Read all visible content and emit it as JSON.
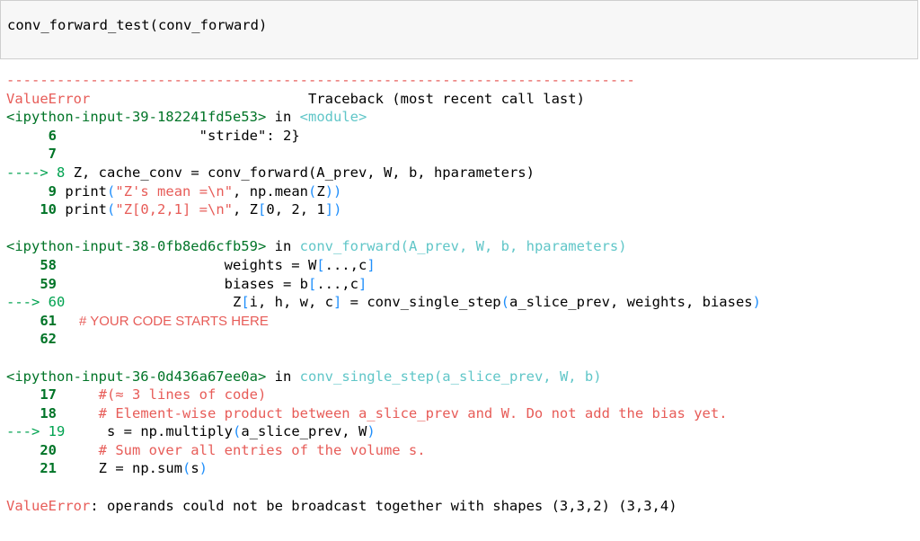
{
  "input": {
    "code": "conv_forward_test(conv_forward)"
  },
  "traceback": {
    "separator": "---------------------------------------------------------------------------",
    "error_name": "ValueError",
    "traceback_header": "Traceback (most recent call last)",
    "frames": [
      {
        "location": "<ipython-input-39-182241fd5e53>",
        "in": "in",
        "func": "<module>",
        "lines": [
          {
            "num": "6",
            "arrow": "",
            "code": "                \"stride\": 2}"
          },
          {
            "num": "7",
            "arrow": "",
            "code": ""
          },
          {
            "num": "8",
            "arrow": "----> ",
            "code": "Z, cache_conv = conv_forward(A_prev, W, b, hparameters)"
          },
          {
            "num": "9",
            "arrow": "",
            "code": "print(\"Z's mean =\\n\", np.mean(Z))"
          },
          {
            "num": "10",
            "arrow": "",
            "code": "print(\"Z[0,2,1] =\\n\", Z[0, 2, 1])"
          }
        ]
      },
      {
        "location": "<ipython-input-38-0fb8ed6cfb59>",
        "in": "in",
        "func": "conv_forward(A_prev, W, b, hparameters)",
        "lines": [
          {
            "num": "58",
            "arrow": "",
            "code": "                    weights = W[...,c]"
          },
          {
            "num": "59",
            "arrow": "",
            "code": "                    biases = b[...,c]"
          },
          {
            "num": "60",
            "arrow": "---> ",
            "code": "                    Z[i, h, w, c] = conv_single_step(a_slice_prev, weights, biases)"
          },
          {
            "num": "61",
            "arrow": "",
            "code": "    # YOUR CODE STARTS HERE"
          },
          {
            "num": "62",
            "arrow": "",
            "code": ""
          }
        ]
      },
      {
        "location": "<ipython-input-36-0d436a67ee0a>",
        "in": "in",
        "func": "conv_single_step(a_slice_prev, W, b)",
        "lines": [
          {
            "num": "17",
            "arrow": "",
            "code": "    #(≈ 3 lines of code)"
          },
          {
            "num": "18",
            "arrow": "",
            "code": "    # Element-wise product between a_slice_prev and W. Do not add the bias yet."
          },
          {
            "num": "19",
            "arrow": "---> ",
            "code": "    s = np.multiply(a_slice_prev, W)"
          },
          {
            "num": "20",
            "arrow": "",
            "code": "    # Sum over all entries of the volume s."
          },
          {
            "num": "21",
            "arrow": "",
            "code": "    Z = np.sum(s)"
          }
        ]
      }
    ],
    "final_error_name": "ValueError",
    "final_error_message": ": operands could not be broadcast together with shapes (3,3,2) (3,3,4)"
  },
  "colors": {
    "error_red": "#e75c58",
    "line_number_green": "#007427",
    "arrow_green": "#00a250",
    "func_cyan": "#60c6c8",
    "input_bg": "#f7f7f7"
  }
}
